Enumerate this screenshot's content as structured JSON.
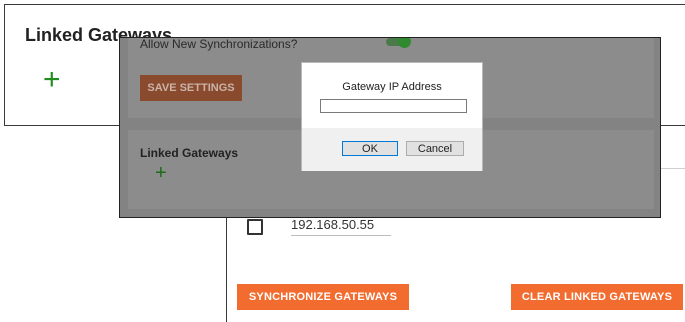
{
  "back_card": {
    "title": "Linked Gateways",
    "add_symbol": "+"
  },
  "settings": {
    "allow_label": "Allow New Synchronizations?",
    "toggle_on": true,
    "save_label": "SAVE SETTINGS",
    "linked_title": "Linked Gateways",
    "add_symbol": "+"
  },
  "gateways": {
    "items": [
      {
        "ip": "192.168.50.55",
        "checked": false
      }
    ],
    "sync_label": "SYNCHRONIZE GATEWAYS",
    "clear_label": "CLEAR LINKED GATEWAYS"
  },
  "dialog": {
    "label": "Gateway IP Address",
    "input_value": "",
    "ok_label": "OK",
    "cancel_label": "Cancel"
  },
  "colors": {
    "accent_orange": "#f26b2f",
    "add_green": "#1e8e1e",
    "focus_blue": "#0078d7"
  }
}
